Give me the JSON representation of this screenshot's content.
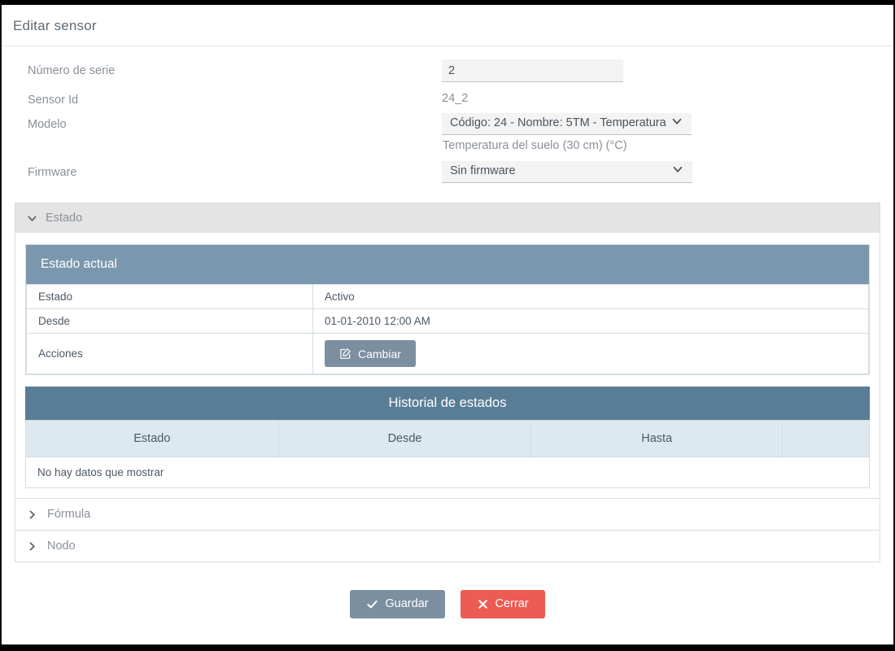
{
  "modal": {
    "title": "Editar sensor"
  },
  "form": {
    "serial": {
      "label": "Número de serie",
      "value": "2",
      "placeholder": ""
    },
    "sensor_id": {
      "label": "Sensor Id",
      "value": "24_2"
    },
    "modelo": {
      "label": "Modelo",
      "selected": "Código: 24 - Nombre: 5TM - Temperatura",
      "helper": "Temperatura del suelo (30 cm) (°C)"
    },
    "firmware": {
      "label": "Firmware",
      "selected": "Sin firmware"
    }
  },
  "accordion": {
    "estado": {
      "label": "Estado",
      "expanded": true
    },
    "formula": {
      "label": "Fórmula",
      "expanded": false
    },
    "nodo": {
      "label": "Nodo",
      "expanded": false
    }
  },
  "estado_actual": {
    "header": "Estado actual",
    "rows": [
      {
        "key": "Estado",
        "value": "Activo"
      },
      {
        "key": "Desde",
        "value": "01-01-2010 12:00 AM"
      }
    ],
    "actions_label": "Acciones",
    "change_button": "Cambiar"
  },
  "historial": {
    "title": "Historial de estados",
    "columns": [
      "Estado",
      "Desde",
      "Hasta",
      ""
    ],
    "rows": [],
    "empty_message": "No hay datos que mostrar"
  },
  "footer": {
    "save_label": "Guardar",
    "close_label": "Cerrar"
  },
  "colors": {
    "slate": "#7b8fa1",
    "red": "#ee5a54",
    "card_header": "#7b97ad",
    "hist_header": "#5a7d96",
    "table_head": "#dce9ef",
    "accordion_bg": "#e4e4e4",
    "muted_text": "#8a9099"
  }
}
